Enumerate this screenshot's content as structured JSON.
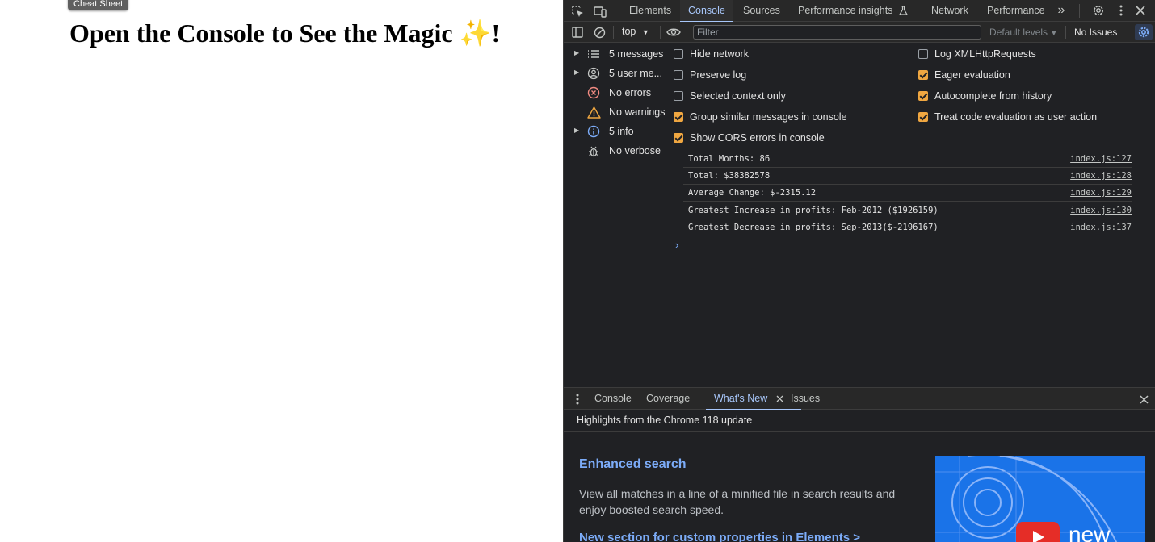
{
  "page": {
    "cheat_sheet_label": "Cheat Sheet",
    "headline": "Open the Console to See the Magic",
    "headline_emoji": "✨",
    "headline_tail": "!"
  },
  "devtools": {
    "tabs": [
      {
        "label": "Elements"
      },
      {
        "label": "Console",
        "active": true
      },
      {
        "label": "Sources"
      },
      {
        "label": "Performance insights"
      },
      {
        "label": "Network"
      },
      {
        "label": "Performance"
      }
    ],
    "toolbar": {
      "context": "top",
      "filter_placeholder": "Filter",
      "levels": "Default levels",
      "issues": "No Issues"
    },
    "sidebar": [
      {
        "label": "5 messages",
        "icon": "list-icon",
        "expandable": true
      },
      {
        "label": "5 user me...",
        "icon": "user-icon",
        "expandable": true
      },
      {
        "label": "No errors",
        "icon": "error-icon",
        "expandable": false
      },
      {
        "label": "No warnings",
        "icon": "warning-icon",
        "expandable": false
      },
      {
        "label": "5 info",
        "icon": "info-icon",
        "expandable": true
      },
      {
        "label": "No verbose",
        "icon": "bug-icon",
        "expandable": false
      }
    ],
    "settings_left": [
      {
        "label": "Hide network",
        "checked": false
      },
      {
        "label": "Preserve log",
        "checked": false
      },
      {
        "label": "Selected context only",
        "checked": false
      },
      {
        "label": "Group similar messages in console",
        "checked": true
      },
      {
        "label": "Show CORS errors in console",
        "checked": true
      }
    ],
    "settings_right": [
      {
        "label": "Log XMLHttpRequests",
        "checked": false
      },
      {
        "label": "Eager evaluation",
        "checked": true
      },
      {
        "label": "Autocomplete from history",
        "checked": true
      },
      {
        "label": "Treat code evaluation as user action",
        "checked": true
      }
    ],
    "log": [
      {
        "message": "Total Months: 86",
        "source": "index.js:127"
      },
      {
        "message": "Total: $38382578",
        "source": "index.js:128"
      },
      {
        "message": "Average Change: $-2315.12",
        "source": "index.js:129"
      },
      {
        "message": "Greatest Increase in profits: Feb-2012 ($1926159)",
        "source": "index.js:130"
      },
      {
        "message": "Greatest Decrease in profits: Sep-2013($-2196167)",
        "source": "index.js:137"
      }
    ],
    "drawer": {
      "tabs": [
        {
          "label": "Console"
        },
        {
          "label": "Coverage"
        },
        {
          "label": "What's New",
          "active": true
        },
        {
          "label": "Issues"
        }
      ],
      "highlights": "Highlights from the Chrome 118 update",
      "feature_title": "Enhanced search",
      "feature_desc": "View all matches in a line of a minified file in search results and enjoy boosted search speed.",
      "next_section": "New section for custom properties in Elements >",
      "promo_text": "new"
    },
    "colors": {
      "accent": "#a8c7fa",
      "checkbox": "#f0a741",
      "link": "#7cacf8",
      "background": "#202124"
    }
  }
}
